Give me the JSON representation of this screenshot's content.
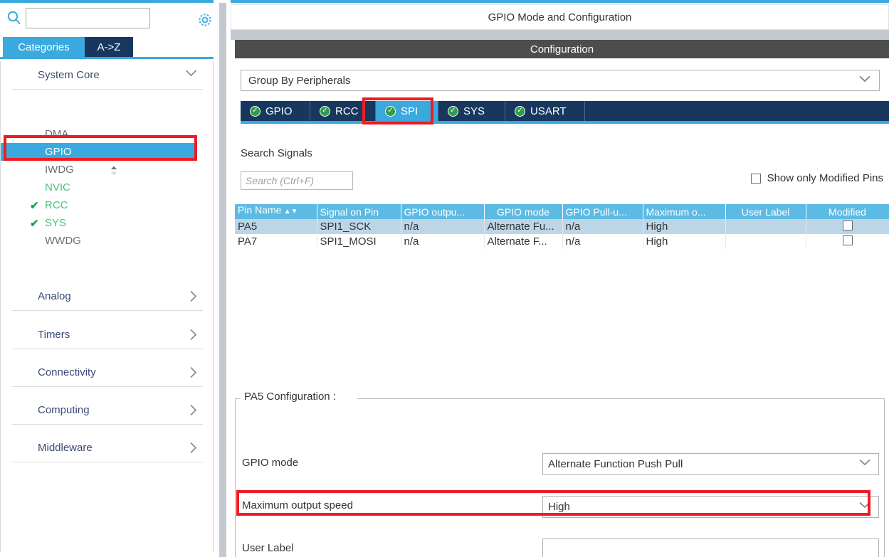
{
  "left_panel": {
    "search": {
      "value": "",
      "placeholder": ""
    },
    "icons": {
      "search": "search-icon",
      "gear": "gear-icon"
    },
    "tabs": [
      {
        "id": "categories",
        "label": "Categories",
        "active": true
      },
      {
        "id": "a-to-z",
        "label": "A->Z",
        "active": false
      }
    ],
    "categories": [
      {
        "label": "System Core",
        "expanded": true,
        "items": [
          {
            "label": "DMA",
            "state": "none",
            "selected": false
          },
          {
            "label": "GPIO",
            "state": "none",
            "selected": true
          },
          {
            "label": "IWDG",
            "state": "none",
            "selected": false
          },
          {
            "label": "NVIC",
            "state": "partial",
            "selected": false
          },
          {
            "label": "RCC",
            "state": "configured",
            "selected": false
          },
          {
            "label": "SYS",
            "state": "configured",
            "selected": false
          },
          {
            "label": "WWDG",
            "state": "none",
            "selected": false
          }
        ]
      },
      {
        "label": "Analog",
        "expanded": false,
        "items": []
      },
      {
        "label": "Timers",
        "expanded": false,
        "items": []
      },
      {
        "label": "Connectivity",
        "expanded": false,
        "items": []
      },
      {
        "label": "Computing",
        "expanded": false,
        "items": []
      },
      {
        "label": "Middleware",
        "expanded": false,
        "items": []
      }
    ]
  },
  "right_panel": {
    "title": "GPIO Mode and Configuration",
    "configuration_header": "Configuration",
    "group_by": {
      "selected": "Group By Peripherals"
    },
    "peripheral_tabs": [
      {
        "label": "GPIO",
        "status": "ok",
        "active": false
      },
      {
        "label": "RCC",
        "status": "ok",
        "active": false
      },
      {
        "label": "SPI",
        "status": "ok",
        "active": true
      },
      {
        "label": "SYS",
        "status": "ok",
        "active": false
      },
      {
        "label": "USART",
        "status": "ok",
        "active": false
      }
    ],
    "search_signals": {
      "label": "Search Signals",
      "value": "",
      "placeholder": "Search (Ctrl+F)"
    },
    "show_modified_pins": {
      "label": "Show only Modified Pins",
      "checked": false
    },
    "pin_table": {
      "columns": [
        "Pin Name",
        "Signal on Pin",
        "GPIO outpu...",
        "GPIO mode",
        "GPIO Pull-u...",
        "Maximum o...",
        "User Label",
        "Modified"
      ],
      "sort_column": "Pin Name",
      "rows": [
        {
          "pin_name": "PA5",
          "signal_on_pin": "SPI1_SCK",
          "gpio_output": "n/a",
          "gpio_mode": "Alternate Fu...",
          "gpio_pull": "n/a",
          "maximum_output": "High",
          "user_label": "",
          "modified": false,
          "selected": true
        },
        {
          "pin_name": "PA7",
          "signal_on_pin": "SPI1_MOSI",
          "gpio_output": "n/a",
          "gpio_mode": "Alternate F...",
          "gpio_pull": "n/a",
          "maximum_output": "High",
          "user_label": "",
          "modified": false,
          "selected": false
        }
      ]
    },
    "pin_config": {
      "legend": "PA5 Configuration :",
      "fields": [
        {
          "label": "GPIO mode",
          "value": "Alternate Function Push Pull",
          "type": "dropdown"
        },
        {
          "label": "Maximum output speed",
          "value": "High",
          "type": "dropdown"
        },
        {
          "label": "User Label",
          "value": "",
          "type": "text"
        }
      ]
    }
  },
  "annotations": {
    "highlight_color": "#ee1b24",
    "boxes": [
      {
        "target": "sidebar-item-gpio"
      },
      {
        "target": "peripheral-tab-spi"
      },
      {
        "target": "config-row-maximum-output-speed"
      }
    ]
  },
  "colors": {
    "accent_blue": "#3aa9dd",
    "dark_navy": "#17375e",
    "header_grey": "#4d4d4d",
    "table_header": "#5cbbe4",
    "row_selected": "#bcd6e8",
    "ok_green": "#2e9e4a",
    "highlight_red": "#ee1b24"
  }
}
